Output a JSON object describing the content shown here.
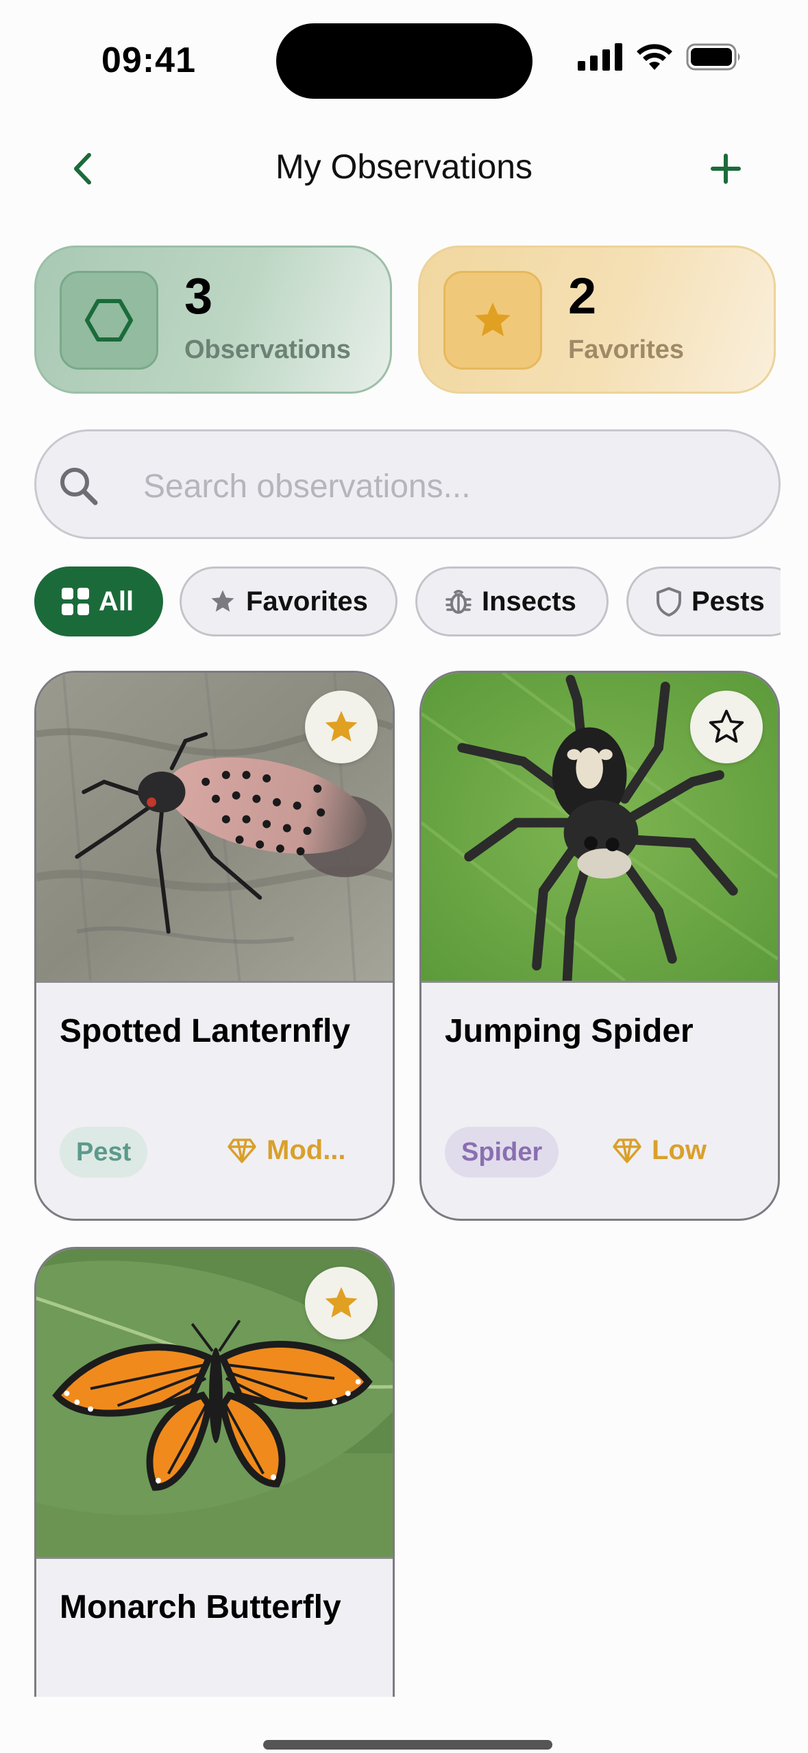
{
  "status_bar": {
    "time": "09:41"
  },
  "nav": {
    "title": "My Observations",
    "back_icon": "chevron-left-icon",
    "add_icon": "plus-icon"
  },
  "stats": {
    "observations": {
      "value": "3",
      "label": "Observations",
      "icon": "hexagon-icon"
    },
    "favorites": {
      "value": "2",
      "label": "Favorites",
      "icon": "star-icon"
    }
  },
  "search": {
    "placeholder": "Search observations...",
    "value": ""
  },
  "filters": [
    {
      "label": "All",
      "icon": "grid-icon",
      "active": true
    },
    {
      "label": "Favorites",
      "icon": "star-icon",
      "active": false
    },
    {
      "label": "Insects",
      "icon": "bug-icon",
      "active": false
    },
    {
      "label": "Pests",
      "icon": "shield-icon",
      "active": false
    }
  ],
  "observations": [
    {
      "name": "Spotted Lanternfly",
      "tag": "Pest",
      "risk": "Mod...",
      "favorite": true
    },
    {
      "name": "Jumping Spider",
      "tag": "Spider",
      "risk": "Low",
      "favorite": false
    },
    {
      "name": "Monarch Butterfly",
      "tag": "",
      "risk": "",
      "favorite": true
    }
  ],
  "colors": {
    "brand_green": "#1b6b3a",
    "favorite_gold": "#e0a021",
    "pest_tag_bg": "#dde9e4",
    "pest_tag_text": "#5c9a8c",
    "spider_tag_bg": "#e1dcec",
    "spider_tag_text": "#8a6fb0"
  }
}
